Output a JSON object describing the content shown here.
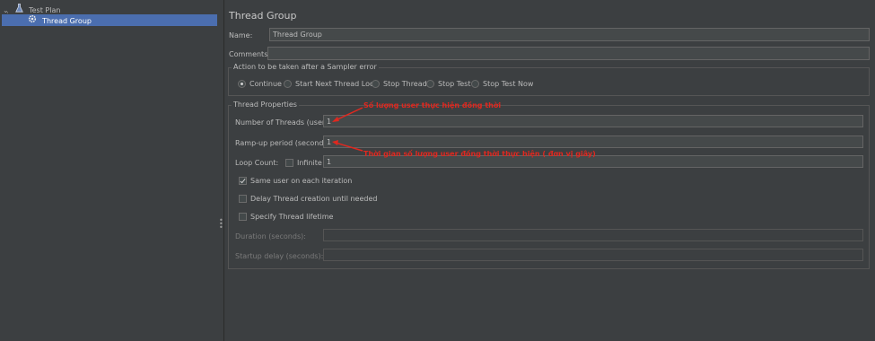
{
  "tree": {
    "test_plan": "Test Plan",
    "thread_group": "Thread Group"
  },
  "panel": {
    "title": "Thread Group",
    "name_label": "Name:",
    "name_value": "Thread Group",
    "comments_label": "Comments:",
    "comments_value": "",
    "sampler_error": {
      "title": "Action to be taken after a Sampler error",
      "options": [
        "Continue",
        "Start Next Thread Loop",
        "Stop Thread",
        "Stop Test",
        "Stop Test Now"
      ],
      "selected": "Continue"
    },
    "thread_properties": {
      "title": "Thread Properties",
      "threads_label": "Number of Threads (users):",
      "threads_value": "1",
      "rampup_label": "Ramp-up period (seconds):",
      "rampup_value": "1",
      "loop_label": "Loop Count:",
      "infinite_label": "Infinite",
      "loop_value": "1",
      "same_user_label": "Same user on each iteration",
      "same_user_checked": true,
      "delay_label": "Delay Thread creation until needed",
      "delay_checked": false,
      "lifetime_label": "Specify Thread lifetime",
      "lifetime_checked": false,
      "duration_label": "Duration (seconds):",
      "duration_value": "",
      "startup_delay_label": "Startup delay (seconds):",
      "startup_delay_value": ""
    }
  },
  "annotations": {
    "threads_note": "Số lượng user thực hiện đồng thời",
    "rampup_note": "Thời gian số lượng user đồng thời thực hiện ( đơn vị giây)"
  },
  "colors": {
    "background": "#3c3f41",
    "selection": "#4b6eaf",
    "annotation": "#e0281f"
  }
}
